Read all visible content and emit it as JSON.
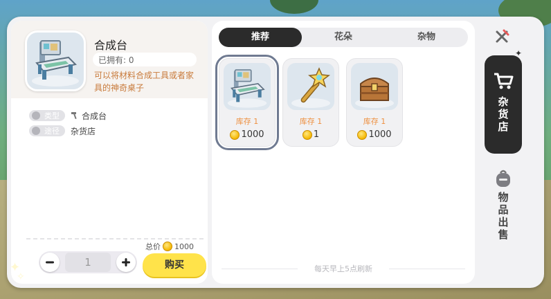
{
  "detail": {
    "name": "合成台",
    "owned": "已拥有: 0",
    "description": "可以将材料合成工具或者家具的神奇桌子",
    "type_label": "类型",
    "type_value": "合成台",
    "source_label": "途径",
    "source_value": "杂货店",
    "total_label": "总价",
    "total_value": "1000",
    "quantity": "1",
    "buy_label": "购买"
  },
  "tabs": [
    {
      "label": "推荐",
      "active": true
    },
    {
      "label": "花朵",
      "active": false
    },
    {
      "label": "杂物",
      "active": false
    }
  ],
  "items": [
    {
      "art": "crafting-table-icon",
      "stock": "库存 1",
      "price": "1000",
      "selected": true
    },
    {
      "art": "star-wand-icon",
      "stock": "库存 1",
      "price": "1",
      "selected": false
    },
    {
      "art": "treasure-chest-icon",
      "stock": "库存 1",
      "price": "1000",
      "selected": false
    }
  ],
  "refresh_note": "每天早上5点刷新",
  "nav": {
    "shop_label": "杂货店",
    "sell_label": "物品出售"
  },
  "colors": {
    "accent_dark": "#2b2b2b",
    "buy_yellow": "#ffe34a",
    "stock_orange": "#ee8f3f",
    "desc_orange": "#c87a3a"
  }
}
